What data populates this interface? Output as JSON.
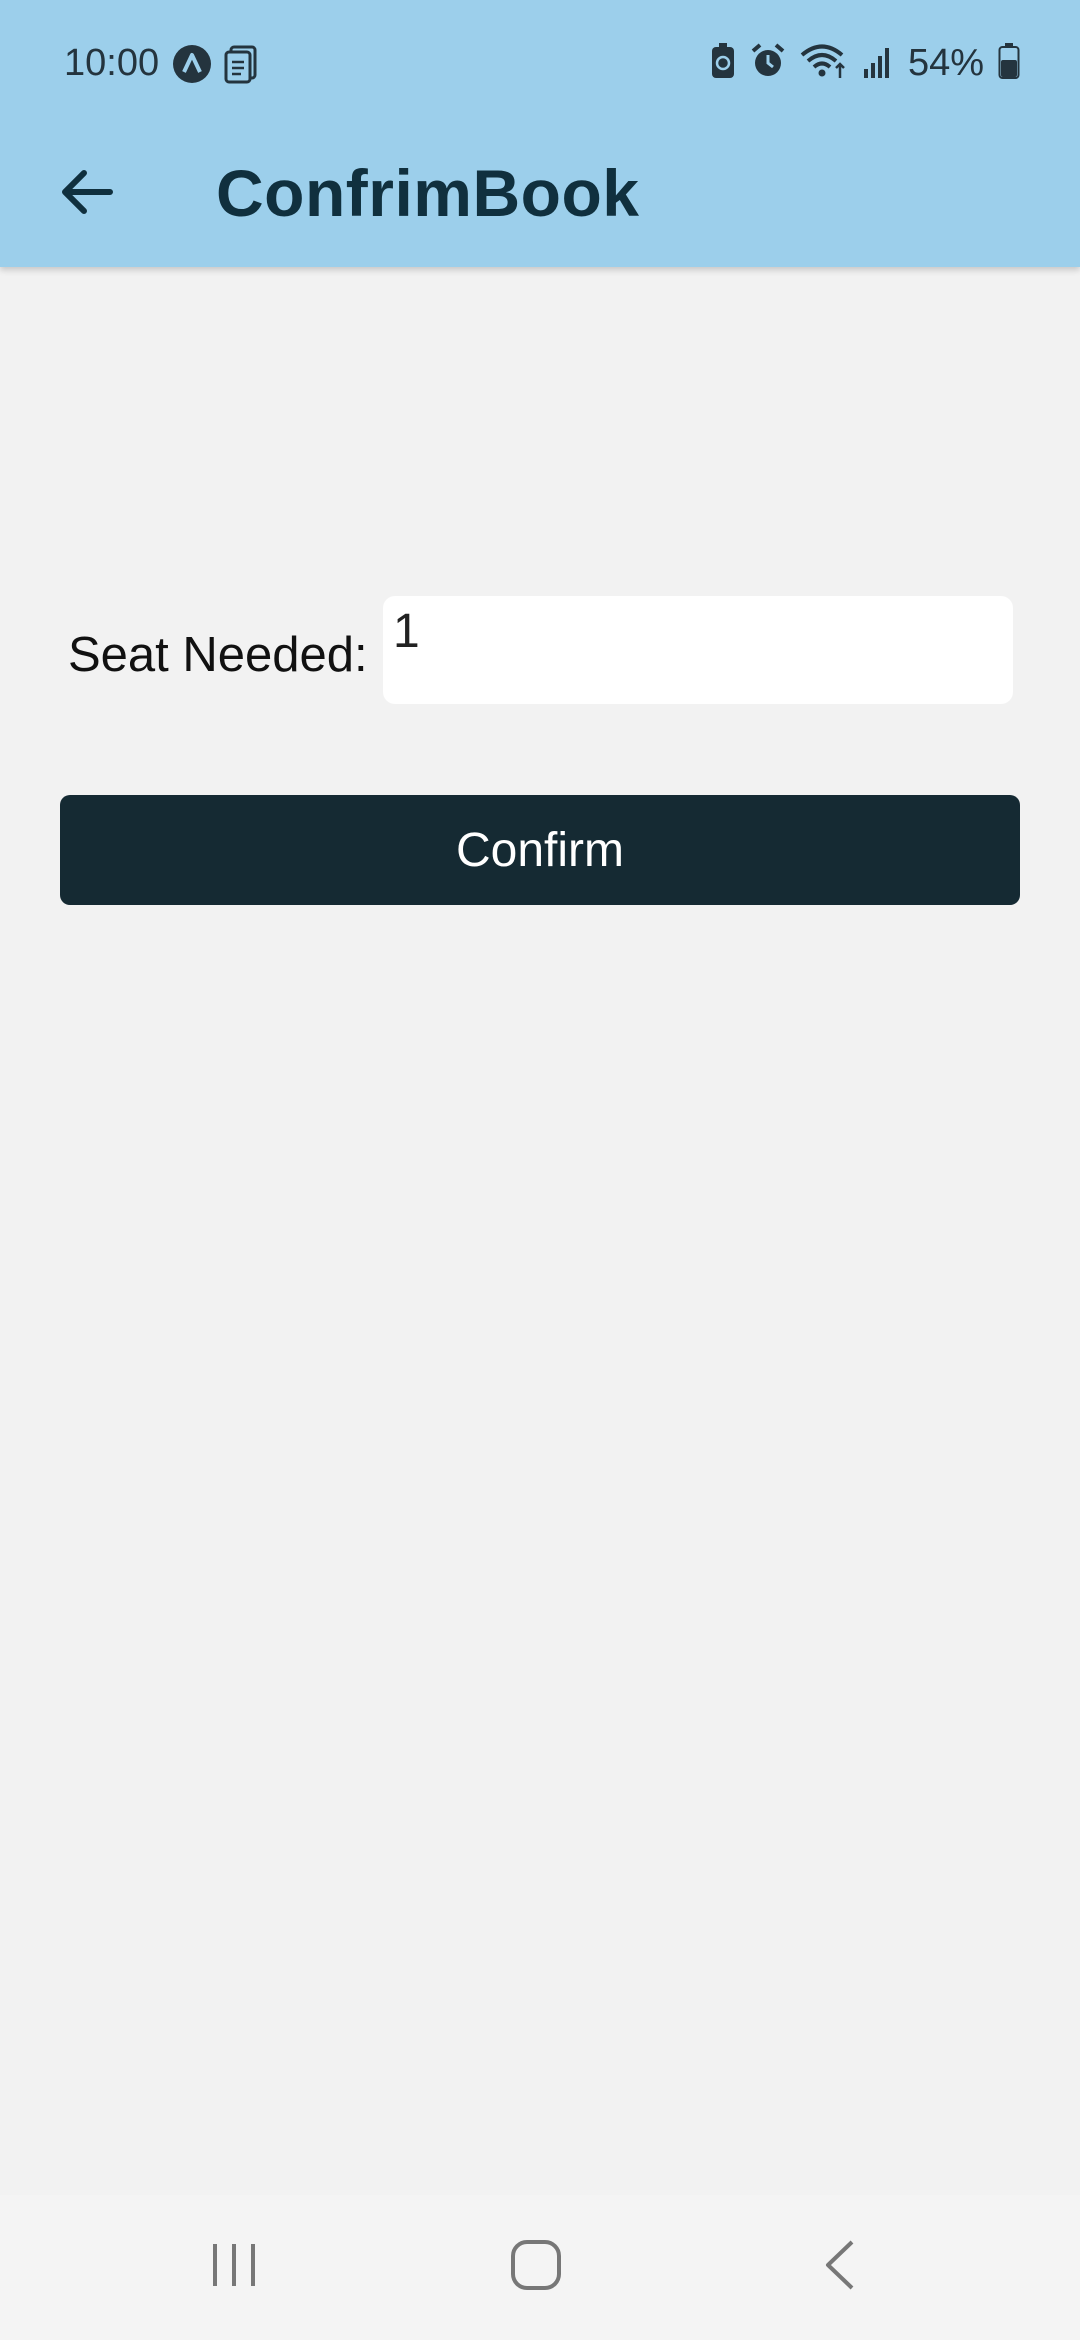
{
  "status_bar": {
    "time": "10:00",
    "battery_percent": "54%",
    "left_icons": [
      "app-notification-icon",
      "document-icon"
    ],
    "right_icons": [
      "battery-saver-icon",
      "alarm-icon",
      "wifi-icon",
      "signal-icon",
      "battery-icon"
    ]
  },
  "app_bar": {
    "title": "ConfrimBook",
    "back_icon": "arrow-left-icon"
  },
  "form": {
    "seat_label": "Seat Needed:",
    "seat_value": "1",
    "confirm_label": "Confirm"
  },
  "nav_bar": {
    "icons": [
      "recent-apps-icon",
      "home-icon",
      "back-icon"
    ]
  },
  "colors": {
    "header_bg": "#9ccfeb",
    "title_text": "#10303e",
    "page_bg": "#f2f2f2",
    "button_bg": "#152a33",
    "button_text": "#ffffff"
  }
}
